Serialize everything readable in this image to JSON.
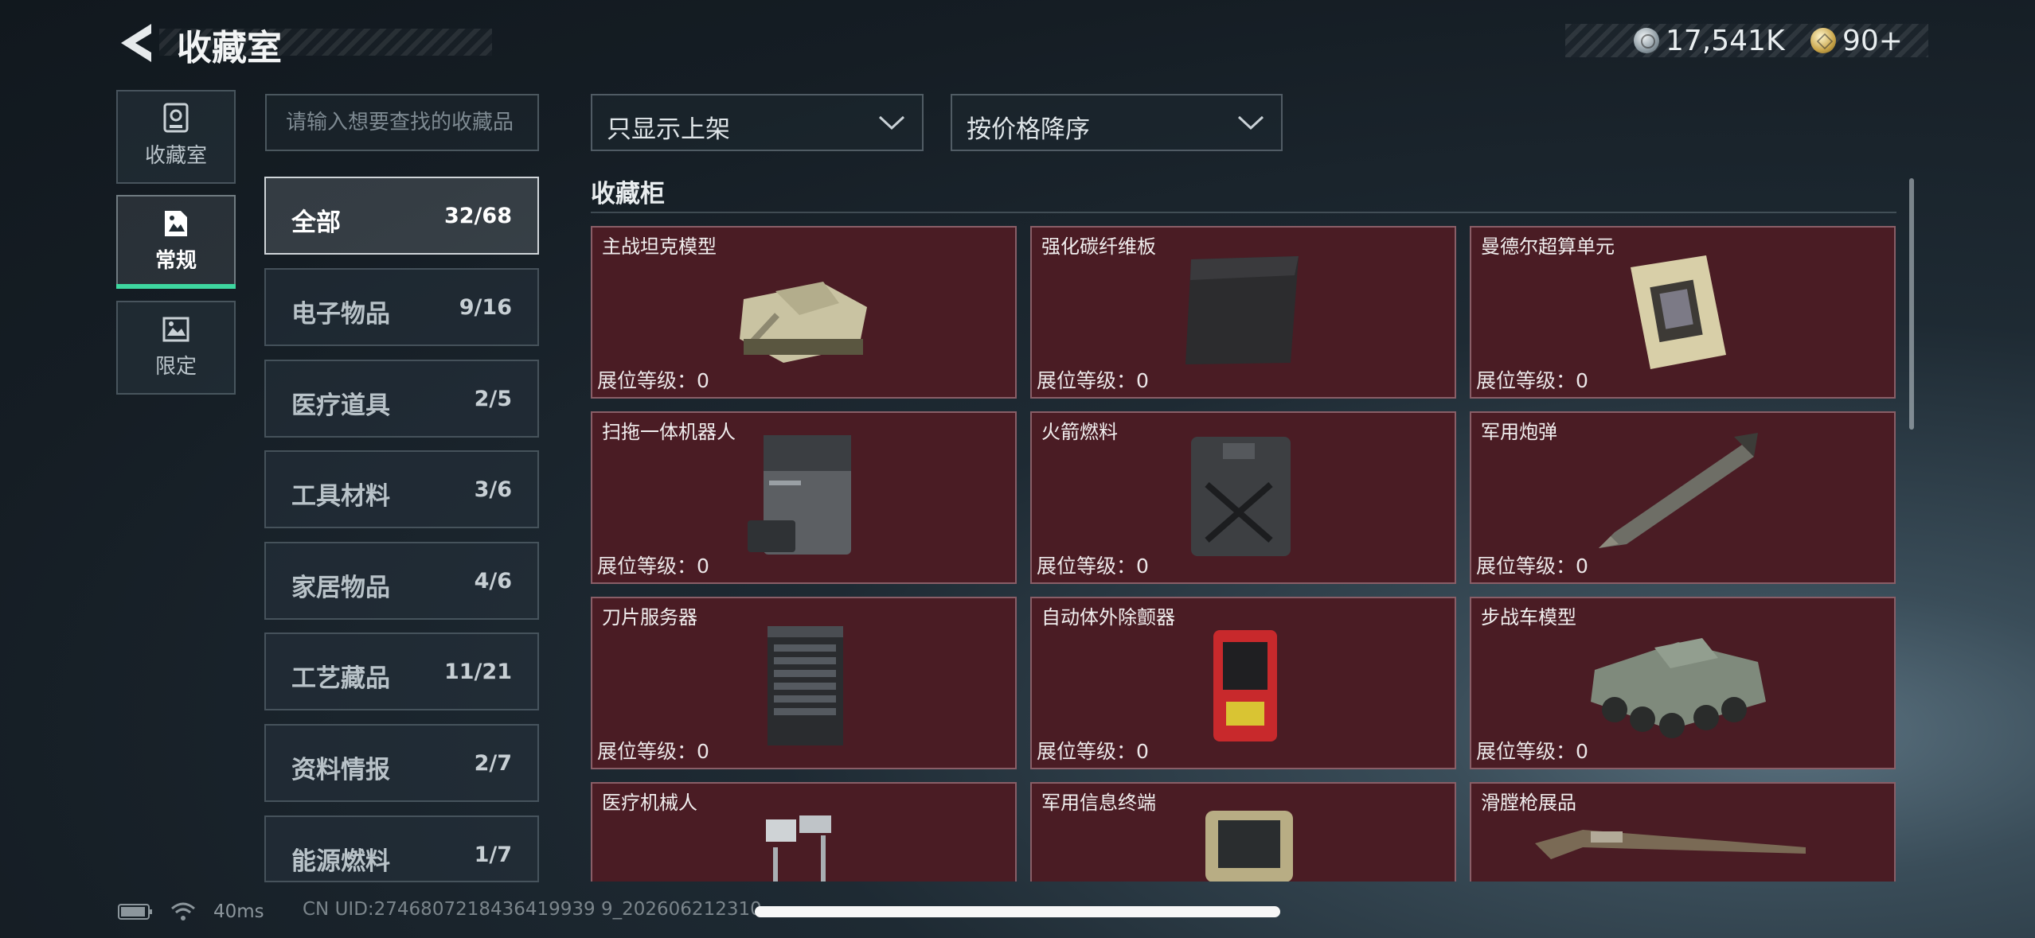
{
  "header": {
    "title": "收藏室",
    "currency": [
      {
        "icon": "silver-coin-icon",
        "amount": "17,541K"
      },
      {
        "icon": "gold-coin-icon",
        "amount": "90+"
      }
    ]
  },
  "side_tabs": [
    {
      "label": "收藏室",
      "icon": "collection-room-icon"
    },
    {
      "label": "常规",
      "icon": "regular-collection-icon",
      "active": true
    },
    {
      "label": "限定",
      "icon": "limited-collection-icon"
    }
  ],
  "search": {
    "placeholder": "请输入想要查找的收藏品",
    "value": ""
  },
  "categories": [
    {
      "name": "全部",
      "count": "32/68",
      "active": true
    },
    {
      "name": "电子物品",
      "count": "9/16"
    },
    {
      "name": "医疗道具",
      "count": "2/5"
    },
    {
      "name": "工具材料",
      "count": "3/6"
    },
    {
      "name": "家居物品",
      "count": "4/6"
    },
    {
      "name": "工艺藏品",
      "count": "11/21"
    },
    {
      "name": "资料情报",
      "count": "2/7"
    },
    {
      "name": "能源燃料",
      "count": "1/7"
    }
  ],
  "filters": {
    "display_filter": "只显示上架",
    "sort_order": "按价格降序"
  },
  "cabinet": {
    "title": "收藏柜",
    "level_label": "展位等级：",
    "items": [
      {
        "name": "主战坦克模型",
        "level": "0",
        "art": "tank-model-icon"
      },
      {
        "name": "强化碳纤维板",
        "level": "0",
        "art": "carbon-plate-icon"
      },
      {
        "name": "曼德尔超算单元",
        "level": "0",
        "art": "compute-unit-icon"
      },
      {
        "name": "扫拖一体机器人",
        "level": "0",
        "art": "cleaning-robot-icon"
      },
      {
        "name": "火箭燃料",
        "level": "0",
        "art": "fuel-canister-icon"
      },
      {
        "name": "军用炮弹",
        "level": "0",
        "art": "artillery-shell-icon"
      },
      {
        "name": "刀片服务器",
        "level": "0",
        "art": "blade-server-icon"
      },
      {
        "name": "自动体外除颤器",
        "level": "0",
        "art": "defibrillator-icon"
      },
      {
        "name": "步战车模型",
        "level": "0",
        "art": "ifv-model-icon"
      },
      {
        "name": "医疗机械人",
        "level": "",
        "art": "medical-robot-icon"
      },
      {
        "name": "军用信息终端",
        "level": "",
        "art": "info-terminal-icon"
      },
      {
        "name": "滑膛枪展品",
        "level": "",
        "art": "musket-icon"
      }
    ]
  },
  "status": {
    "ping": "40ms",
    "uid": "CN UID:2746807218436419939 9_202606212310"
  }
}
